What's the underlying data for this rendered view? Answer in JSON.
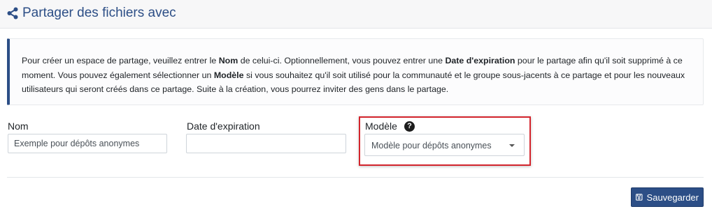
{
  "header": {
    "icon": "share-icon",
    "title": "Partager des fichiers avec"
  },
  "info": {
    "segments": [
      {
        "text": "Pour créer un espace de partage, veuillez entrer le ",
        "bold": false
      },
      {
        "text": "Nom",
        "bold": true
      },
      {
        "text": " de celui-ci. Optionnellement, vous pouvez entrer une ",
        "bold": false
      },
      {
        "text": "Date d'expiration",
        "bold": true
      },
      {
        "text": " pour le partage afin qu'il soit supprimé à ce moment. Vous pouvez également sélectionner un ",
        "bold": false
      },
      {
        "text": "Modèle",
        "bold": true
      },
      {
        "text": " si vous souhaitez qu'il soit utilisé pour la communauté et le groupe sous-jacents à ce partage et pour les nouveaux utilisateurs qui seront créés dans ce partage. Suite à la création, vous pourrez inviter des gens dans le partage.",
        "bold": false
      }
    ]
  },
  "form": {
    "name": {
      "label": "Nom",
      "value": "Exemple pour dépôts anonymes"
    },
    "expiration": {
      "label": "Date d'expiration",
      "value": ""
    },
    "model": {
      "label": "Modèle",
      "help_icon": "question-circle-icon",
      "selected": "Modèle pour dépôts anonymes"
    }
  },
  "actions": {
    "save_label": "Sauvegarder",
    "save_icon": "floppy-disk-icon"
  },
  "colors": {
    "primary": "#2c4e86",
    "highlight": "#d3242c"
  }
}
